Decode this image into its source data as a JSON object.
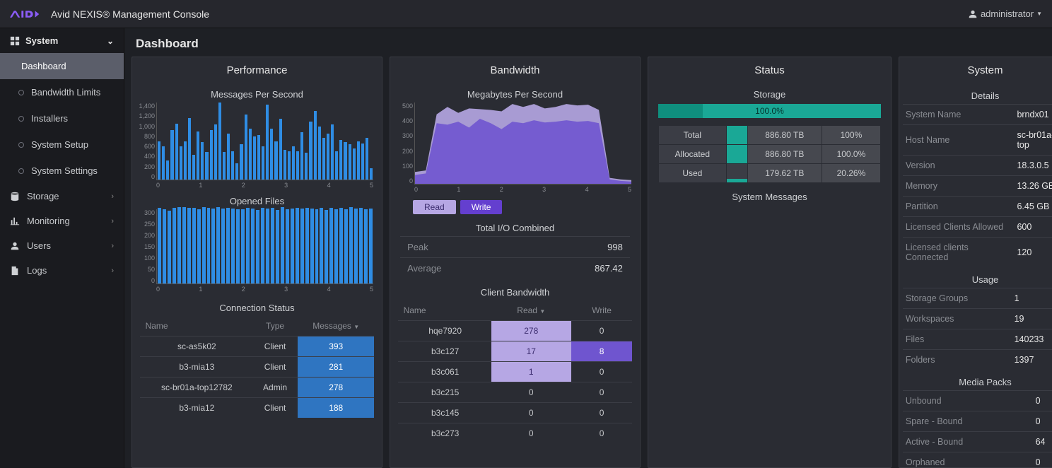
{
  "header": {
    "app_title": "Avid NEXIS® Management Console",
    "user": "administrator"
  },
  "sidebar": {
    "system": {
      "label": "System",
      "items": [
        "Dashboard",
        "Bandwidth Limits",
        "Installers",
        "System Setup",
        "System Settings"
      ],
      "active": 0
    },
    "groups": [
      "Storage",
      "Monitoring",
      "Users",
      "Logs"
    ]
  },
  "page": {
    "title": "Dashboard"
  },
  "performance": {
    "title": "Performance",
    "msgs_title": "Messages Per Second",
    "files_title": "Opened Files",
    "conn_title": "Connection Status",
    "conn_cols": [
      "Name",
      "Type",
      "Messages"
    ],
    "conn_rows": [
      {
        "name": "sc-as5k02",
        "type": "Client",
        "msgs": 393
      },
      {
        "name": "b3-mia13",
        "type": "Client",
        "msgs": 281
      },
      {
        "name": "sc-br01a-top12782",
        "type": "Admin",
        "msgs": 278
      },
      {
        "name": "b3-mia12",
        "type": "Client",
        "msgs": 188
      }
    ]
  },
  "bandwidth": {
    "title": "Bandwidth",
    "mbps_title": "Megabytes Per Second",
    "pills": {
      "read": "Read",
      "write": "Write"
    },
    "combined_title": "Total I/O Combined",
    "combined": {
      "peak_label": "Peak",
      "peak": 998,
      "avg_label": "Average",
      "avg": "867.42"
    },
    "client_title": "Client Bandwidth",
    "client_cols": [
      "Name",
      "Read",
      "Write"
    ],
    "client_rows": [
      {
        "name": "hqe7920",
        "read": 278,
        "write": 0,
        "hr": true,
        "hw": false
      },
      {
        "name": "b3c127",
        "read": 17,
        "write": 8,
        "hr": true,
        "hw": true
      },
      {
        "name": "b3c061",
        "read": 1,
        "write": 0,
        "hr": true,
        "hw": false
      },
      {
        "name": "b3c215",
        "read": 0,
        "write": 0
      },
      {
        "name": "b3c145",
        "read": 0,
        "write": 0
      },
      {
        "name": "b3c273",
        "read": 0,
        "write": 0
      }
    ]
  },
  "status": {
    "title": "Status",
    "storage_title": "Storage",
    "bar": "100.0%",
    "rows": [
      {
        "label": "Total",
        "val": "886.80 TB",
        "pct": "100%",
        "gauge": 100
      },
      {
        "label": "Allocated",
        "val": "886.80 TB",
        "pct": "100.0%",
        "gauge": 100
      },
      {
        "label": "Used",
        "val": "179.62 TB",
        "pct": "20.26%",
        "gauge": 20
      }
    ],
    "sys_msgs": "System Messages"
  },
  "system": {
    "title": "System",
    "details_title": "Details",
    "details": [
      [
        "System Name",
        "brndx01"
      ],
      [
        "Host Name",
        "sc-br01a-top"
      ],
      [
        "Version",
        "18.3.0.5"
      ],
      [
        "Memory",
        "13.26 GB"
      ],
      [
        "Partition",
        "6.45 GB"
      ],
      [
        "Licensed Clients Allowed",
        "600"
      ],
      [
        "Licensed clients Connected",
        "120"
      ]
    ],
    "usage_title": "Usage",
    "usage": [
      [
        "Storage Groups",
        "1"
      ],
      [
        "Workspaces",
        "19"
      ],
      [
        "Files",
        "140233"
      ],
      [
        "Folders",
        "1397"
      ]
    ],
    "packs_title": "Media Packs",
    "packs": [
      [
        "Unbound",
        "0"
      ],
      [
        "Spare - Bound",
        "0"
      ],
      [
        "Active - Bound",
        "64"
      ],
      [
        "Orphaned",
        "0"
      ]
    ]
  },
  "chart_data": [
    {
      "type": "bar",
      "id": "messages_per_second",
      "title": "Messages Per Second",
      "x": [
        0,
        1,
        2,
        3,
        4,
        5
      ],
      "ylim": [
        0,
        1400
      ],
      "yticks": [
        0,
        200,
        400,
        600,
        800,
        1000,
        1200,
        1400
      ],
      "values": [
        700,
        600,
        350,
        900,
        1020,
        610,
        700,
        1120,
        450,
        880,
        680,
        500,
        900,
        1000,
        1400,
        500,
        830,
        520,
        290,
        640,
        1180,
        920,
        790,
        810,
        610,
        1360,
        920,
        690,
        1110,
        540,
        520,
        600,
        510,
        860,
        490,
        1050,
        1250,
        960,
        760,
        830,
        1000,
        510,
        720,
        680,
        640,
        560,
        700,
        650,
        760,
        200
      ]
    },
    {
      "type": "bar",
      "id": "opened_files",
      "title": "Opened Files",
      "x": [
        0,
        1,
        2,
        3,
        4,
        5
      ],
      "ylim": [
        0,
        300
      ],
      "yticks": [
        0,
        50,
        100,
        150,
        200,
        250,
        300
      ],
      "values": [
        305,
        300,
        294,
        305,
        308,
        310,
        307,
        305,
        299,
        308,
        305,
        302,
        309,
        304,
        306,
        303,
        300,
        301,
        306,
        304,
        298,
        306,
        303,
        307,
        296,
        308,
        300,
        302,
        305,
        304,
        306,
        303,
        300,
        306,
        298,
        307,
        300,
        305,
        301,
        308,
        303,
        306,
        300,
        304
      ]
    },
    {
      "type": "area",
      "id": "bandwidth_mbps",
      "title": "Megabytes Per Second",
      "x": [
        0,
        1,
        2,
        3,
        4,
        5
      ],
      "ylim": [
        0,
        500
      ],
      "yticks": [
        0,
        100,
        200,
        300,
        400,
        500
      ],
      "series": [
        {
          "name": "Read",
          "color": "#b6a7e4",
          "values": [
            80,
            90,
            470,
            520,
            480,
            510,
            505,
            500,
            490,
            540,
            520,
            540,
            510,
            520,
            540,
            530,
            535,
            500,
            40,
            30,
            25
          ]
        },
        {
          "name": "Write",
          "color": "#6f55cf",
          "values": [
            60,
            70,
            410,
            400,
            420,
            380,
            440,
            410,
            370,
            420,
            410,
            430,
            415,
            420,
            430,
            420,
            425,
            410,
            30,
            20,
            15
          ]
        }
      ]
    }
  ]
}
